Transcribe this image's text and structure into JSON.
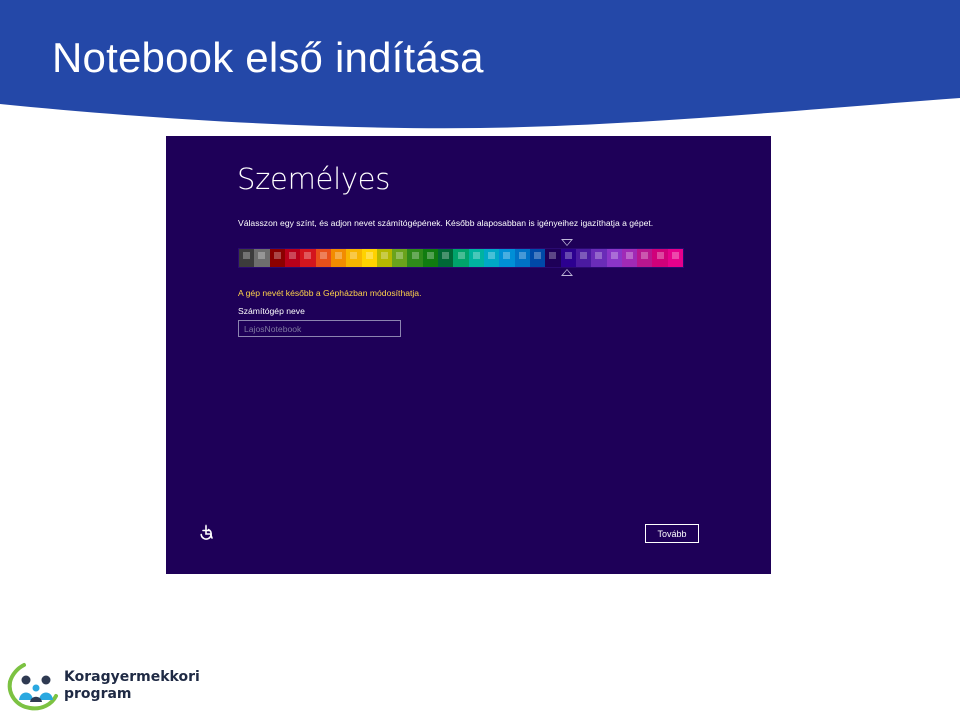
{
  "slide": {
    "title": "Notebook első indítása"
  },
  "setup": {
    "heading": "Személyes",
    "instruction": "Válasszon egy színt, és adjon nevet számítógépének. Később alaposabban is igényeihez igazíthatja a gépet.",
    "hint": "A gép nevét később a Gépházban módosíthatja.",
    "computer_name_label": "Számítógép neve",
    "computer_name_placeholder": "LajosNotebook",
    "next_button": "Tovább",
    "selected_color_index": 18,
    "palette": [
      "#3c3c3c",
      "#6e6e6e",
      "#8b0000",
      "#b8001a",
      "#d4151d",
      "#e8501a",
      "#f28c00",
      "#f7b500",
      "#ffd200",
      "#b5b800",
      "#6aa31c",
      "#2f8a1a",
      "#107c10",
      "#006837",
      "#00a36b",
      "#00b3a0",
      "#00a8c6",
      "#008fd6",
      "#0072c6",
      "#0049a8",
      "#1e0058",
      "#2c0090",
      "#4a1aa0",
      "#6a2cb8",
      "#8a35c8",
      "#a02ab6",
      "#b8168f",
      "#d0007a",
      "#e6008c"
    ]
  },
  "logo": {
    "line1": "Koragyermekkori",
    "line2": "program"
  },
  "colors": {
    "banner": "#2448a8",
    "screen_background": "#1e0058",
    "hint_text": "#ffd24a"
  },
  "icons": {
    "accessibility": "ease-of-access-icon"
  }
}
